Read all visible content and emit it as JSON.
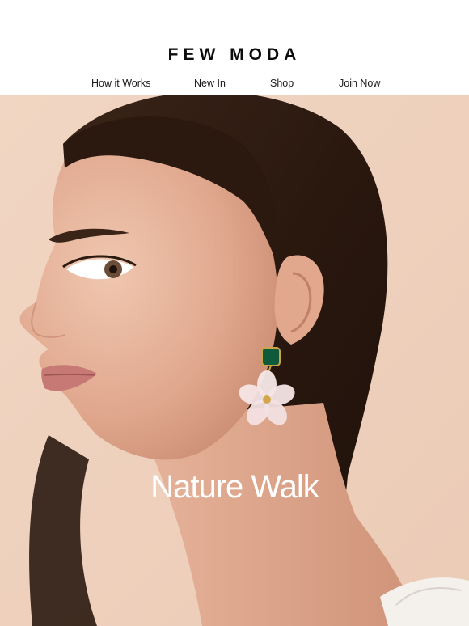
{
  "brand": {
    "logo_text": "FEW MODA"
  },
  "nav": {
    "items": [
      {
        "label": "How it Works"
      },
      {
        "label": "New In"
      },
      {
        "label": "Shop"
      },
      {
        "label": "Join Now"
      }
    ]
  },
  "hero": {
    "title": "Nature Walk",
    "background_color": "#efd3c0",
    "image_description_icon": "model-portrait-image"
  },
  "colors": {
    "header_bg": "#ffffff",
    "text_dark": "#0d0d0d",
    "hero_text": "#ffffff"
  }
}
